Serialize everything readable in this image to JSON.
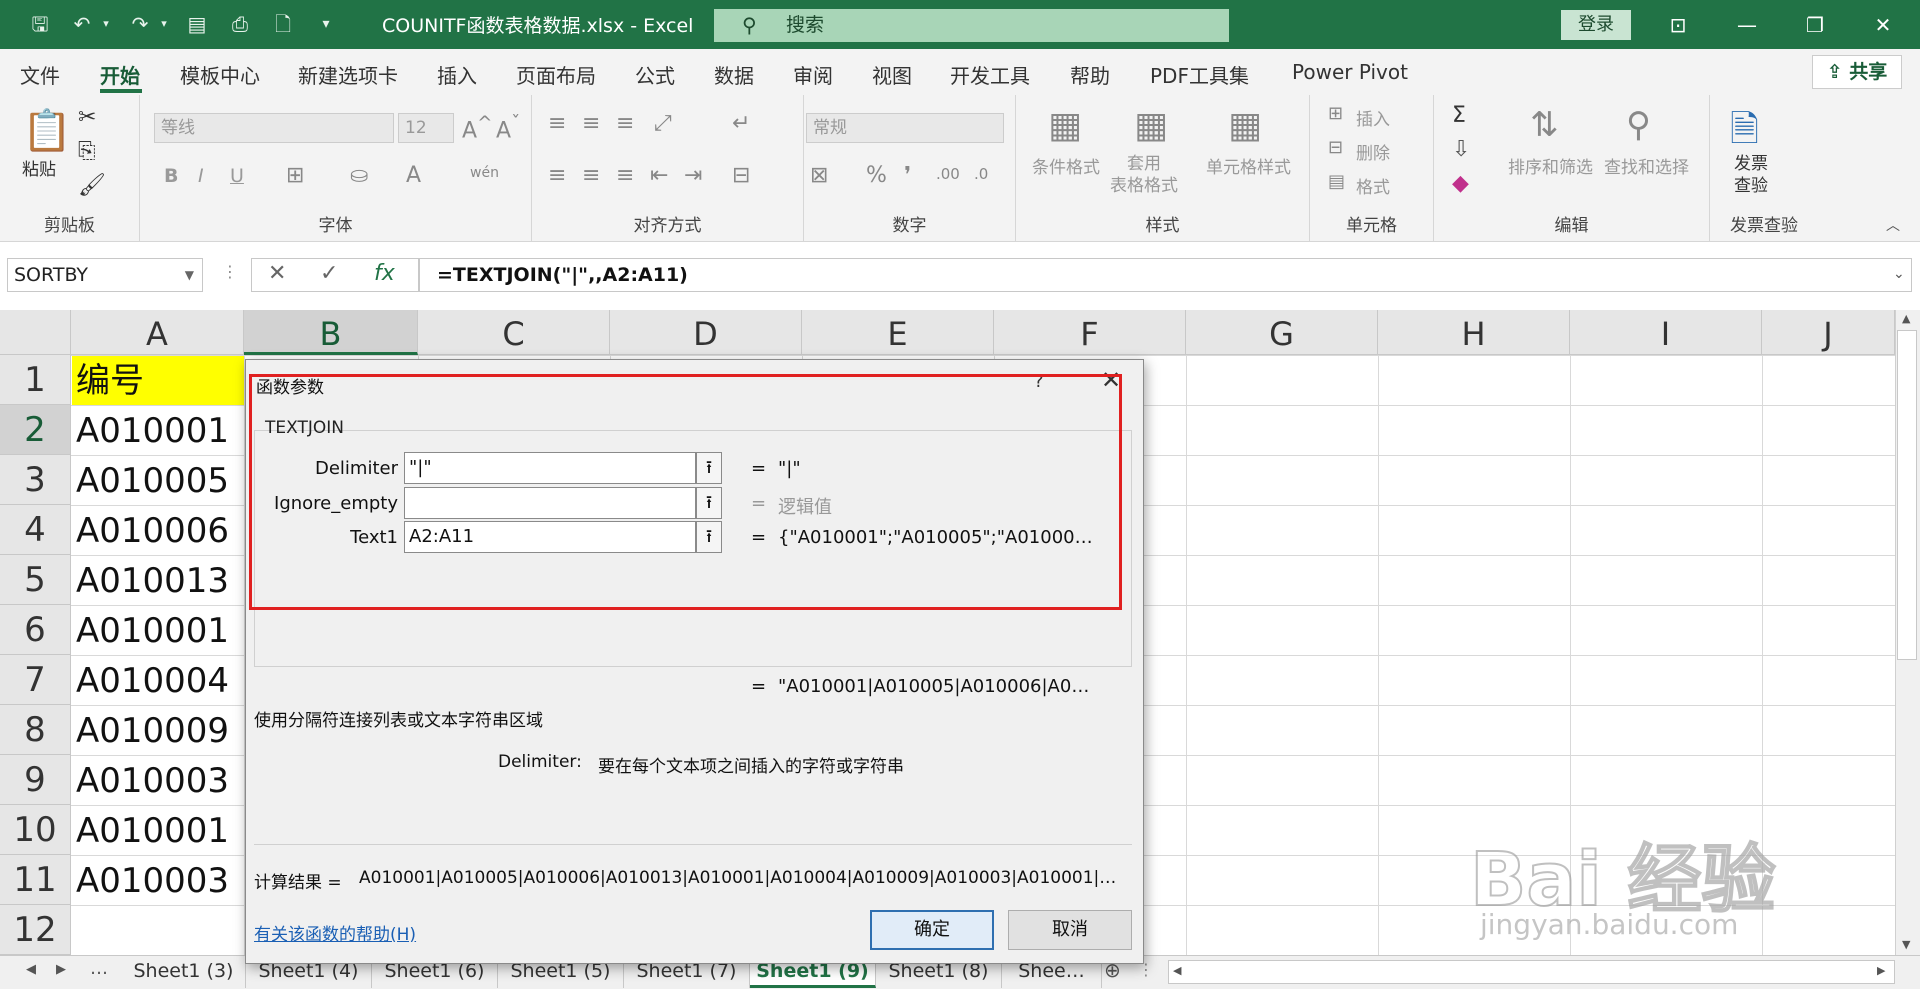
{
  "app": {
    "document_title": "COUNITF函数表格数据.xlsx  -  Excel",
    "search_placeholder": "搜索",
    "login_label": "登录",
    "share_label": "共享"
  },
  "menu": [
    "文件",
    "开始",
    "模板中心",
    "新建选项卡",
    "插入",
    "页面布局",
    "公式",
    "数据",
    "审阅",
    "视图",
    "开发工具",
    "帮助",
    "PDF工具集",
    "Power Pivot"
  ],
  "ribbon": {
    "clipboard": {
      "label": "剪贴板",
      "paste": "粘贴"
    },
    "font": {
      "label": "字体",
      "font_name": "等线",
      "font_size": "12",
      "bold": "B",
      "italic": "I",
      "underline": "U"
    },
    "alignment": {
      "label": "对齐方式"
    },
    "number": {
      "label": "数字",
      "format": "常规"
    },
    "styles": {
      "label": "样式",
      "cond_format": "条件格式",
      "table_format": "套用\n表格格式",
      "cell_style": "单元格样式"
    },
    "cells": {
      "label": "单元格",
      "insert": "插入",
      "delete": "删除",
      "format": "格式"
    },
    "editing": {
      "label": "编辑",
      "sort_filter": "排序和筛选",
      "find_select": "查找和选择"
    },
    "invoice": {
      "label": "发票查验",
      "button": "发票\n查验"
    }
  },
  "formula_bar": {
    "name_box": "SORTBY",
    "formula": "=TEXTJOIN(\"|\",,A2:A11)"
  },
  "columns": [
    "A",
    "B",
    "C",
    "D",
    "E",
    "F",
    "G",
    "H",
    "I",
    "J"
  ],
  "rows": [
    "1",
    "2",
    "3",
    "4",
    "5",
    "6",
    "7",
    "8",
    "9",
    "10",
    "11",
    "12"
  ],
  "cells_a": [
    "编号",
    "A010001",
    "A010005",
    "A010006",
    "A010013",
    "A010001",
    "A010004",
    "A010009",
    "A010003",
    "A010001",
    "A010003"
  ],
  "sheet_tabs": [
    "Sheet1 (3)",
    "Sheet1 (4)",
    "Sheet1 (6)",
    "Sheet1 (5)",
    "Sheet1 (7)",
    "Sheet1 (9)",
    "Sheet1 (8)",
    "Shee…"
  ],
  "dialog": {
    "title": "函数参数",
    "help_q": "?",
    "function_name": "TEXTJOIN",
    "params": [
      {
        "label": "Delimiter",
        "value": "\"|\"",
        "result": "\"|\"",
        "gray": false
      },
      {
        "label": "Ignore_empty",
        "value": "",
        "result": "逻辑值",
        "gray": true
      },
      {
        "label": "Text1",
        "value": "A2:A11",
        "result": "{\"A010001\";\"A010005\";\"A01000…",
        "gray": false
      }
    ],
    "result_eq": "=",
    "result_value": "\"A010001|A010005|A010006|A0…",
    "description": "使用分隔符连接列表或文本字符串区域",
    "arg_name": "Delimiter:",
    "arg_description": "要在每个文本项之间插入的字符或字符串",
    "calc_label": "计算结果 =",
    "calc_value": "A010001|A010005|A010006|A010013|A010001|A010004|A010009|A010003|A010001|…",
    "help_link": "有关该函数的帮助(H)",
    "ok": "确定",
    "cancel": "取消"
  },
  "watermark": {
    "main": "Bai 经验",
    "sub": "jingyan.baidu.com"
  },
  "colors": {
    "excel_green": "#217346",
    "highlight_yellow": "#ffff00",
    "annotation_red": "#e02020"
  }
}
